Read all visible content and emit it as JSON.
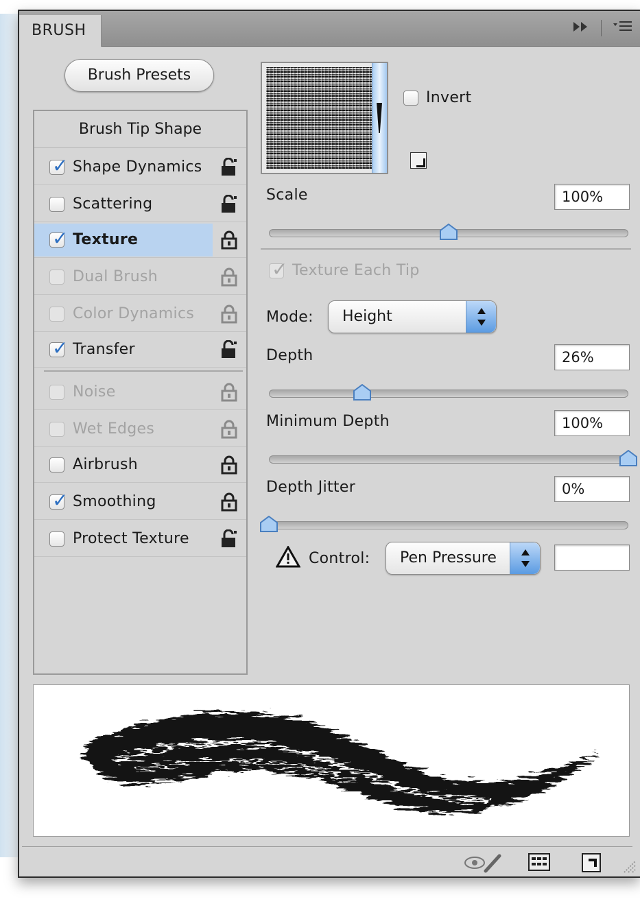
{
  "panel": {
    "tab_label": "BRUSH",
    "menu_icons": [
      "double-arrow-right-icon",
      "panel-menu-icon"
    ]
  },
  "presets_button": "Brush Presets",
  "options_list": {
    "header": "Brush Tip Shape",
    "items": [
      {
        "label": "Shape Dynamics",
        "checked": true,
        "enabled": true,
        "selected": false,
        "lock": "unlocked"
      },
      {
        "label": "Scattering",
        "checked": false,
        "enabled": true,
        "selected": false,
        "lock": "unlocked"
      },
      {
        "label": "Texture",
        "checked": true,
        "enabled": true,
        "selected": true,
        "lock": "locked"
      },
      {
        "label": "Dual Brush",
        "checked": false,
        "enabled": false,
        "selected": false,
        "lock": "locked"
      },
      {
        "label": "Color Dynamics",
        "checked": false,
        "enabled": false,
        "selected": false,
        "lock": "locked"
      },
      {
        "label": "Transfer",
        "checked": true,
        "enabled": true,
        "selected": false,
        "lock": "unlocked"
      },
      {
        "label": "Noise",
        "checked": false,
        "enabled": false,
        "selected": false,
        "lock": "locked"
      },
      {
        "label": "Wet Edges",
        "checked": false,
        "enabled": false,
        "selected": false,
        "lock": "locked"
      },
      {
        "label": "Airbrush",
        "checked": false,
        "enabled": true,
        "selected": false,
        "lock": "locked"
      },
      {
        "label": "Smoothing",
        "checked": true,
        "enabled": true,
        "selected": false,
        "lock": "locked"
      },
      {
        "label": "Protect Texture",
        "checked": false,
        "enabled": true,
        "selected": false,
        "lock": "unlocked"
      }
    ]
  },
  "texture": {
    "invert_label": "Invert",
    "invert_checked": false,
    "scale_label": "Scale",
    "scale_value": "100%",
    "scale_fraction": 0.5,
    "each_tip_label": "Texture Each Tip",
    "each_tip_checked": true,
    "mode_label": "Mode:",
    "mode_value": "Height",
    "depth_label": "Depth",
    "depth_value": "26%",
    "depth_fraction": 0.26,
    "min_depth_label": "Minimum Depth",
    "min_depth_value": "100%",
    "min_depth_fraction": 1.0,
    "depth_jitter_label": "Depth Jitter",
    "depth_jitter_value": "0%",
    "depth_jitter_fraction": 0.0,
    "control_label": "Control:",
    "control_value": "Pen Pressure",
    "control_extra_value": ""
  },
  "footer_icons": [
    "toggle-live-tip-preview-icon",
    "open-preset-manager-icon",
    "create-new-brush-icon",
    "resize-grip-icon"
  ],
  "colors": {
    "panel_bg": "#d6d6d6",
    "selection": "#b9d3f0",
    "checkmark": "#2d6fc1",
    "accent_blue": "#5b9be2"
  }
}
